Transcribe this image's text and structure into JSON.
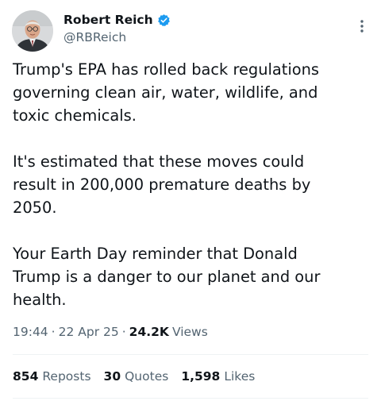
{
  "author": {
    "name": "Robert Reich",
    "handle": "@RBReich",
    "verified_color": "#1d9bf0"
  },
  "tweet": {
    "paragraphs": [
      "Trump's EPA has rolled back regulations\ngoverning clean air, water, wildlife, and\ntoxic chemicals.",
      "It's estimated that these moves could\nresult in 200,000 premature deaths by\n2050.",
      "Your Earth Day reminder that Donald\nTrump is a danger to our planet and our\nhealth."
    ]
  },
  "meta": {
    "time": "19:44",
    "separator": "·",
    "date": "22 Apr 25",
    "views_count": "24.2K",
    "views_label": "Views"
  },
  "stats": {
    "reposts_count": "854",
    "reposts_label": "Reposts",
    "quotes_count": "30",
    "quotes_label": "Quotes",
    "likes_count": "1,598",
    "likes_label": "Likes"
  },
  "icons": {
    "verified": "verified-badge-icon",
    "more": "more-vertical-icon"
  }
}
